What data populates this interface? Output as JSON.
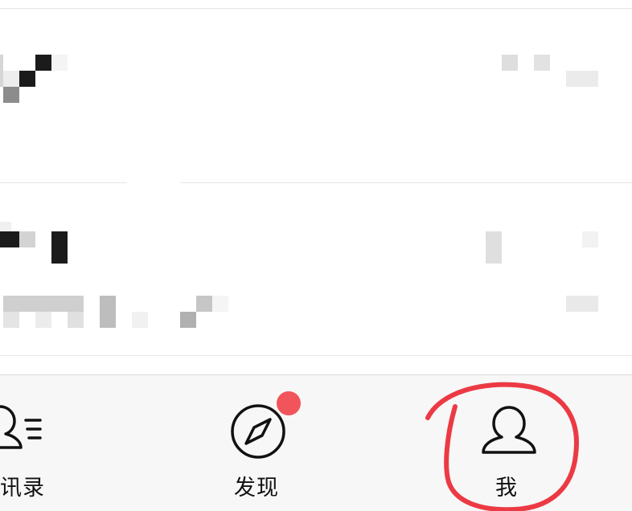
{
  "tabbar": {
    "tabs": [
      {
        "label": "讯录",
        "icon": "contacts-icon",
        "selected": false
      },
      {
        "label": "发现",
        "icon": "compass-icon",
        "selected": false,
        "badge": true
      },
      {
        "label": "我",
        "icon": "person-icon",
        "selected": false
      }
    ],
    "badge_color": "#f2545b"
  },
  "annotation": {
    "shape": "hand-drawn circle around 我 tab",
    "color": "#ec3a44"
  },
  "conversation_rows": [
    {
      "content": "mosaic-redacted"
    },
    {
      "content": "mosaic-redacted"
    }
  ]
}
